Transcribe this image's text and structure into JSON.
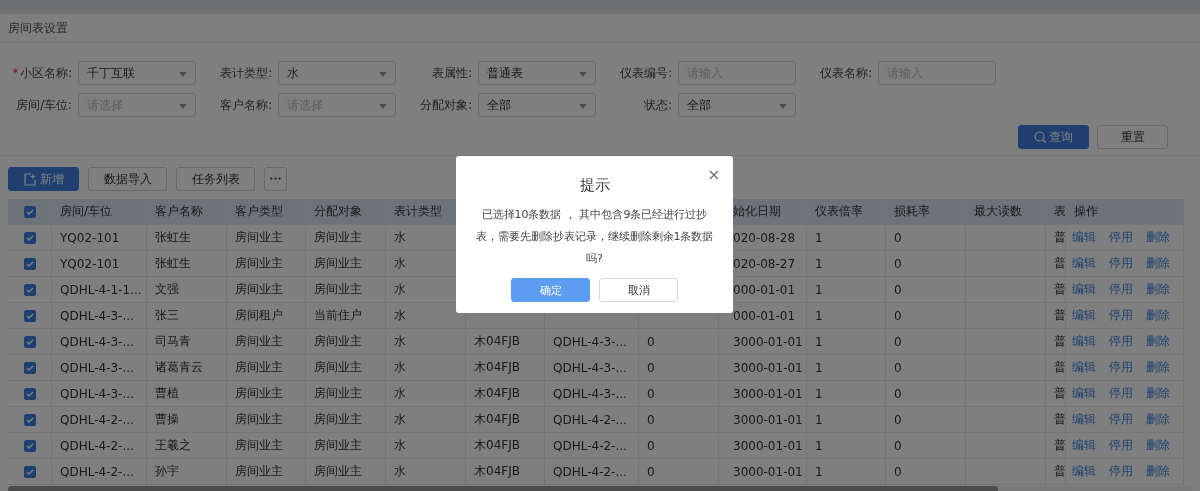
{
  "page_title": "房间表设置",
  "filters": [
    {
      "label": "小区名称:",
      "required_mark": "*",
      "kind": "select",
      "value": "千丁互联"
    },
    {
      "label": "表计类型:",
      "kind": "select",
      "value": "水"
    },
    {
      "label": "表属性:",
      "kind": "select",
      "value": "普通表"
    },
    {
      "label": "仪表编号:",
      "kind": "input",
      "placeholder": "请输入"
    },
    {
      "label": "仪表名称:",
      "kind": "input",
      "placeholder": "请输入"
    },
    {
      "label": "房间/车位:",
      "kind": "select",
      "placeholder": "请选择"
    },
    {
      "label": "客户名称:",
      "kind": "select",
      "placeholder": "请选择"
    },
    {
      "label": "分配对象:",
      "kind": "select",
      "value": "全部"
    },
    {
      "label": "状态:",
      "kind": "select",
      "value": "全部"
    }
  ],
  "search_button": "查询",
  "reset_button": "重置",
  "toolbar": {
    "add_button": "新增",
    "buttons": [
      "数据导入",
      "任务列表"
    ],
    "more_button": "•••"
  },
  "table": {
    "all_checked": true,
    "columns": [
      "房间/车位",
      "客户名称",
      "客户类型",
      "分配对象",
      "表计类型",
      null,
      null,
      null,
      "始化日期",
      "仪表倍率",
      "损耗率",
      "最大读数",
      "表",
      "操作"
    ],
    "rows": [
      {
        "checked": true,
        "cells": [
          "YQ02-101",
          "张虹生",
          "房间业主",
          "房间业主",
          "水",
          null,
          null,
          null,
          "020-08-28",
          "1",
          "0",
          null,
          "普"
        ],
        "actions": [
          "编辑",
          "停用",
          "删除"
        ]
      },
      {
        "checked": true,
        "cells": [
          "YQ02-101",
          "张虹生",
          "房间业主",
          "房间业主",
          "水",
          null,
          null,
          null,
          "020-08-27",
          "1",
          "0",
          null,
          "普"
        ],
        "actions": [
          "编辑",
          "停用",
          "删除"
        ]
      },
      {
        "checked": true,
        "cells": [
          "QDHL-4-1-1...",
          "文强",
          "房间业主",
          "房间业主",
          "水",
          null,
          null,
          null,
          "000-01-01",
          "1",
          "0",
          null,
          "普"
        ],
        "actions": [
          "编辑",
          "停用",
          "删除"
        ]
      },
      {
        "checked": true,
        "cells": [
          "QDHL-4-3-...",
          "张三",
          "房间租户",
          "当前住户",
          "水",
          null,
          null,
          null,
          "000-01-01",
          "1",
          "0",
          null,
          "普"
        ],
        "actions": [
          "编辑",
          "停用",
          "删除"
        ]
      },
      {
        "checked": true,
        "cells": [
          "QDHL-4-3-...",
          "司马青",
          "房间业主",
          "房间业主",
          "水",
          "木04FJB",
          "QDHL-4-3-...",
          "0",
          "3000-01-01",
          "1",
          "0",
          null,
          "普"
        ],
        "actions": [
          "编辑",
          "停用",
          "删除"
        ]
      },
      {
        "checked": true,
        "cells": [
          "QDHL-4-3-...",
          "诸葛青云",
          "房间业主",
          "房间业主",
          "水",
          "木04FJB",
          "QDHL-4-3-...",
          "0",
          "3000-01-01",
          "1",
          "0",
          null,
          "普"
        ],
        "actions": [
          "编辑",
          "停用",
          "删除"
        ]
      },
      {
        "checked": true,
        "cells": [
          "QDHL-4-3-...",
          "曹植",
          "房间业主",
          "房间业主",
          "水",
          "木04FJB",
          "QDHL-4-3-...",
          "0",
          "3000-01-01",
          "1",
          "0",
          null,
          "普"
        ],
        "actions": [
          "编辑",
          "停用",
          "删除"
        ]
      },
      {
        "checked": true,
        "cells": [
          "QDHL-4-2-...",
          "曹操",
          "房间业主",
          "房间业主",
          "水",
          "木04FJB",
          "QDHL-4-2-...",
          "0",
          "3000-01-01",
          "1",
          "0",
          null,
          "普"
        ],
        "actions": [
          "编辑",
          "停用",
          "删除"
        ]
      },
      {
        "checked": true,
        "cells": [
          "QDHL-4-2-...",
          "王羲之",
          "房间业主",
          "房间业主",
          "水",
          "木04FJB",
          "QDHL-4-2-...",
          "0",
          "3000-01-01",
          "1",
          "0",
          null,
          "普"
        ],
        "actions": [
          "编辑",
          "停用",
          "删除"
        ]
      },
      {
        "checked": true,
        "cells": [
          "QDHL-4-2-...",
          "孙宇",
          "房间业主",
          "房间业主",
          "水",
          "木04FJB",
          "QDHL-4-2-...",
          "0",
          "3000-01-01",
          "1",
          "0",
          null,
          "普"
        ],
        "actions": [
          "编辑",
          "停用",
          "删除"
        ]
      }
    ]
  },
  "dialog": {
    "title": "提示",
    "message": "已选择10条数据 ， 其中包含9条已经进行过抄表，需要先删除抄表记录，继续删除剩余1条数据吗?",
    "confirm_button": "确定",
    "cancel_button": "取消"
  }
}
